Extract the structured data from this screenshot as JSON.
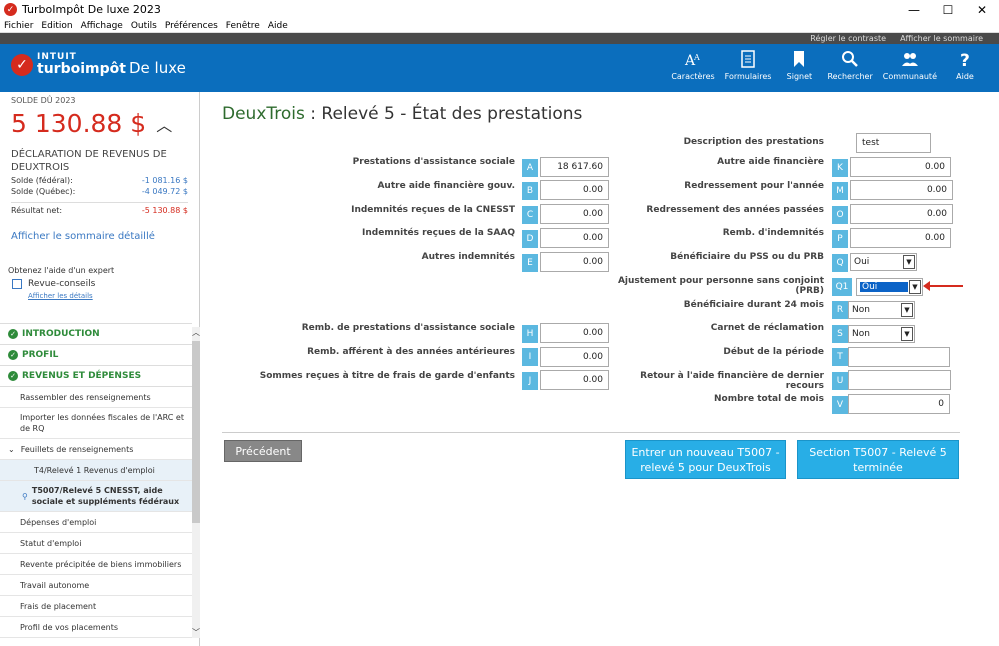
{
  "window": {
    "title": "TurboImpôt De luxe 2023"
  },
  "menu": [
    "Fichier",
    "Edition",
    "Affichage",
    "Outils",
    "Préférences",
    "Fenêtre",
    "Aide"
  ],
  "topstrip": {
    "contrast": "Régler le contraste",
    "summary": "Afficher le sommaire"
  },
  "header": {
    "brand_top": "INTUIT",
    "brand_bottom": "turboimpôt",
    "edition": "De luxe",
    "icons": [
      {
        "label": "Caractères",
        "icon": "font-icon"
      },
      {
        "label": "Formulaires",
        "icon": "document-icon"
      },
      {
        "label": "Signet",
        "icon": "bookmark-icon"
      },
      {
        "label": "Rechercher",
        "icon": "search-icon"
      },
      {
        "label": "Communauté",
        "icon": "people-icon"
      },
      {
        "label": "Aide",
        "icon": "help-icon"
      }
    ]
  },
  "sidebar": {
    "solde_label": "SOLDE DÛ 2023",
    "solde_amount": "5 130.88 $",
    "decl_title": "DÉCLARATION DE REVENUS DE DEUXTROIS",
    "rows": [
      {
        "label": "Solde (fédéral):",
        "value": "-1 081.16 $"
      },
      {
        "label": "Solde (Québec):",
        "value": "-4 049.72 $"
      },
      {
        "label": "Résultat net:",
        "value": "-5 130.88 $"
      }
    ],
    "summary_link": "Afficher le sommaire détaillé",
    "expert_text": "Obtenez l'aide d'un expert",
    "revue": "Revue-conseils",
    "details_link": "Afficher les détails",
    "sections": [
      "INTRODUCTION",
      "PROFIL",
      "REVENUS ET DÉPENSES"
    ],
    "items": [
      "Rassembler des renseignements",
      "Importer les données fiscales de l'ARC et de RQ",
      "Feuillets de renseignements",
      "T4/Relevé 1 Revenus d'emploi",
      "T5007/Relevé 5 CNESST, aide sociale et suppléments fédéraux",
      "Dépenses d'emploi",
      "Statut d'emploi",
      "Revente précipitée de biens immobiliers",
      "Travail autonome",
      "Frais de placement",
      "Profil de vos placements"
    ]
  },
  "page": {
    "title_name": "DeuxTrois",
    "title_rest": " : Relevé 5 - État des prestations",
    "description_label": "Description des prestations",
    "description_value": "test",
    "left_fields": [
      {
        "label": "Prestations d'assistance sociale",
        "letter": "A",
        "value": "18 617.60"
      },
      {
        "label": "Autre aide financière gouv.",
        "letter": "B",
        "value": "0.00"
      },
      {
        "label": "Indemnités reçues de la CNESST",
        "letter": "C",
        "value": "0.00"
      },
      {
        "label": "Indemnités reçues de la SAAQ",
        "letter": "D",
        "value": "0.00"
      },
      {
        "label": "Autres indemnités",
        "letter": "E",
        "value": "0.00"
      },
      {
        "label": "Remb. de prestations d'assistance sociale",
        "letter": "H",
        "value": "0.00"
      },
      {
        "label": "Remb. afférent à des années antérieures",
        "letter": "I",
        "value": "0.00"
      },
      {
        "label": "Sommes reçues à titre de frais de garde d'enfants",
        "letter": "J",
        "value": "0.00"
      }
    ],
    "right_fields": [
      {
        "label": "Autre aide financière",
        "letter": "K",
        "value": "0.00"
      },
      {
        "label": "Redressement pour l'année",
        "letter": "M",
        "value": "0.00"
      },
      {
        "label": "Redressement des années passées",
        "letter": "O",
        "value": "0.00"
      },
      {
        "label": "Remb. d'indemnités",
        "letter": "P",
        "value": "0.00"
      },
      {
        "label": "Bénéficiaire du PSS ou du PRB",
        "letter": "Q",
        "value": "Oui"
      },
      {
        "label": "Ajustement pour personne sans conjoint (PRB)",
        "letter": "Q1",
        "value": "Oui"
      },
      {
        "label": "Bénéficiaire durant 24 mois",
        "letter": "R",
        "value": "Non"
      },
      {
        "label": "Carnet de réclamation",
        "letter": "S",
        "value": "Non"
      },
      {
        "label": "Début de la période",
        "letter": "T",
        "value": ""
      },
      {
        "label": "Retour à l'aide financière de dernier recours",
        "letter": "U",
        "value": ""
      },
      {
        "label": "Nombre total de mois",
        "letter": "V",
        "value": "0"
      }
    ],
    "btn_prev": "Précédent",
    "btn_new": "Entrer un nouveau T5007 - relevé 5 pour DeuxTrois",
    "btn_done": "Section T5007 - Relevé 5 terminée"
  }
}
